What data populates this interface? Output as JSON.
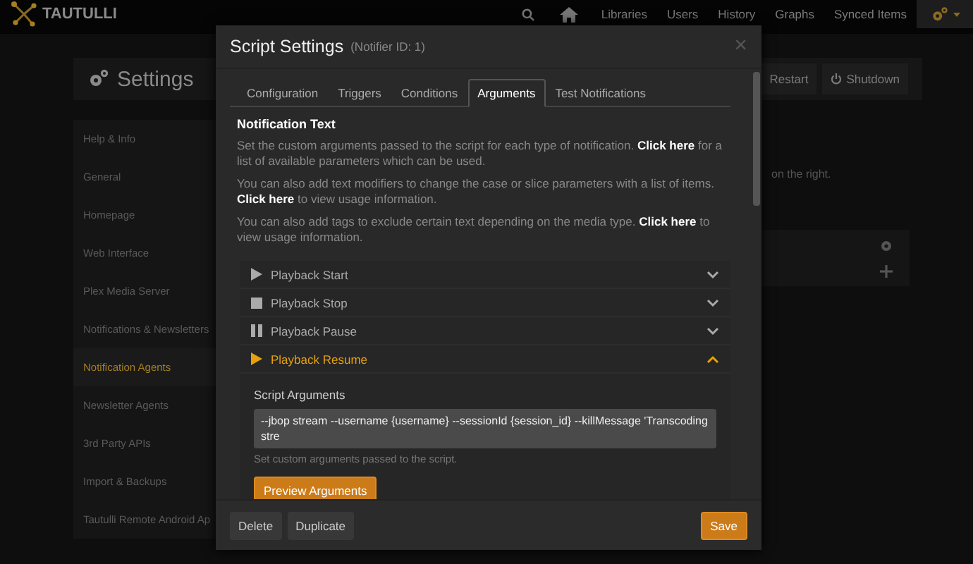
{
  "navbar": {
    "brand": "TAUTULLI",
    "links": [
      {
        "label": "Libraries"
      },
      {
        "label": "Users"
      },
      {
        "label": "History"
      },
      {
        "label": "Graphs"
      },
      {
        "label": "Synced Items"
      }
    ]
  },
  "settings": {
    "title": "Settings",
    "buttons": [
      {
        "label": "Restart",
        "kind": "plain"
      },
      {
        "label": "Shutdown",
        "kind": "power"
      }
    ],
    "sidebar": [
      {
        "label": "Help & Info",
        "selected": false
      },
      {
        "label": "General",
        "selected": false
      },
      {
        "label": "Homepage",
        "selected": false
      },
      {
        "label": "Web Interface",
        "selected": false
      },
      {
        "label": "Plex Media Server",
        "selected": false
      },
      {
        "label": "Notifications & Newsletters",
        "selected": false
      },
      {
        "label": "Notification Agents",
        "selected": true
      },
      {
        "label": "Newsletter Agents",
        "selected": false
      },
      {
        "label": "3rd Party APIs",
        "selected": false
      },
      {
        "label": "Import & Backups",
        "selected": false
      },
      {
        "label": "Tautulli Remote Android Ap",
        "selected": false
      }
    ],
    "hint": "on the right."
  },
  "modal": {
    "title": "Script Settings",
    "subtitle": "(Notifier ID: 1)",
    "close": "×",
    "tabs": [
      {
        "label": "Configuration",
        "selected": false
      },
      {
        "label": "Triggers",
        "selected": false
      },
      {
        "label": "Conditions",
        "selected": false
      },
      {
        "label": "Arguments",
        "selected": true
      },
      {
        "label": "Test Notifications",
        "selected": false
      }
    ],
    "heading": "Notification Text",
    "paragraphs": [
      {
        "before": "Set the custom arguments passed to the script for each type of notification.",
        "link": "Click here",
        "after": "for a list of available parameters which can be used."
      },
      {
        "before": "You can also add text modifiers to change the case or slice parameters with a list of items.",
        "link": "Click here",
        "after": "to view usage information."
      },
      {
        "before": "You can also add tags to exclude certain text depending on the media type.",
        "link": "Click here",
        "after": "to view usage information."
      }
    ],
    "events": [
      {
        "label": "Playback Start",
        "kind": "play",
        "expanded": false
      },
      {
        "label": "Playback Stop",
        "kind": "stop",
        "expanded": false
      },
      {
        "label": "Playback Pause",
        "kind": "pause",
        "expanded": false
      },
      {
        "label": "Playback Resume",
        "kind": "play",
        "expanded": true
      }
    ],
    "arguments": {
      "label": "Script Arguments",
      "value": "--jbop stream --username {username} --sessionId {session_id} --killMessage 'Transcoding stre",
      "help": "Set custom arguments passed to the script.",
      "button": "Preview Arguments"
    },
    "footer": {
      "left": [
        "Delete",
        "Duplicate"
      ],
      "save": "Save"
    }
  }
}
